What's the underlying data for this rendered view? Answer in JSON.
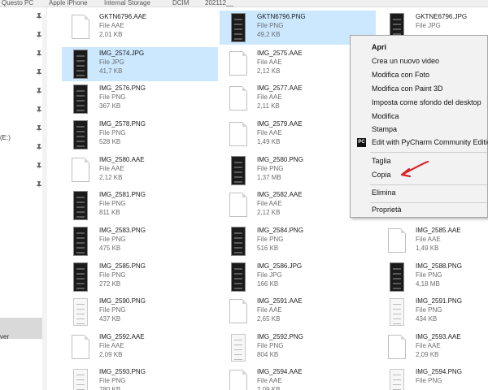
{
  "address": {
    "crumbs": [
      "Questo PC",
      "Apple iPhone",
      "Internal Storage",
      "DCIM",
      "202112__"
    ]
  },
  "nav": {
    "drive_label": "(E:)",
    "server_label": "ver"
  },
  "files": [
    {
      "name": "GKTN6796.AAE",
      "type": "File AAE",
      "size": "2,01 KB",
      "icon": "doc"
    },
    {
      "name": "GKTN6796.PNG",
      "type": "File PNG",
      "size": "49,2 KB",
      "icon": "phone"
    },
    {
      "name": "GKTNE6796.JPG",
      "type": "File JPG",
      "size": "",
      "icon": "phone"
    },
    {
      "name": "IMG_2574.JPG",
      "type": "File JPG",
      "size": "41,7 KB",
      "icon": "phone"
    },
    {
      "name": "IMG_2575.AAE",
      "type": "File AAE",
      "size": "2,12 KB",
      "icon": "doc"
    },
    {
      "name": "IMG_2576.PNG",
      "type": "File PNG",
      "size": "367 KB",
      "icon": "phone"
    },
    {
      "name": "IMG_2577.AAE",
      "type": "File AAE",
      "size": "2,11 KB",
      "icon": "doc"
    },
    {
      "name": "IMG_2578.PNG",
      "type": "File PNG",
      "size": "528 KB",
      "icon": "phone"
    },
    {
      "name": "IMG_2579.AAE",
      "type": "File AAE",
      "size": "1,49 KB",
      "icon": "doc"
    },
    {
      "name": "IMG_2580.AAE",
      "type": "File AAE",
      "size": "2,12 KB",
      "icon": "doc"
    },
    {
      "name": "IMG_2580.PNG",
      "type": "File PNG",
      "size": "1,37 MB",
      "icon": "phone"
    },
    {
      "name": "IMG_2581.PNG",
      "type": "File PNG",
      "size": "811 KB",
      "icon": "phone"
    },
    {
      "name": "IMG_2582.AAE",
      "type": "File AAE",
      "size": "2,12 KB",
      "icon": "doc"
    },
    {
      "name": "IMG_2583.PNG",
      "type": "File PNG",
      "size": "475 KB",
      "icon": "phone"
    },
    {
      "name": "IMG_2584.PNG",
      "type": "File PNG",
      "size": "516 KB",
      "icon": "phone"
    },
    {
      "name": "IMG_2585.AAE",
      "type": "File AAE",
      "size": "1,49 KB",
      "icon": "doc"
    },
    {
      "name": "IMG_2585.PNG",
      "type": "File PNG",
      "size": "272 KB",
      "icon": "phone"
    },
    {
      "name": "IMG_2586.JPG",
      "type": "File JPG",
      "size": "166 KB",
      "icon": "phone"
    },
    {
      "name": "IMG_2588.PNG",
      "type": "File PNG",
      "size": "4,18 MB",
      "icon": "phone"
    },
    {
      "name": "IMG_2590.PNG",
      "type": "File PNG",
      "size": "437 KB",
      "icon": "white"
    },
    {
      "name": "IMG_2591.AAE",
      "type": "File AAE",
      "size": "2,65 KB",
      "icon": "doc"
    },
    {
      "name": "IMG_2591.PNG",
      "type": "File PNG",
      "size": "434 KB",
      "icon": "white"
    },
    {
      "name": "IMG_2592.AAE",
      "type": "File AAE",
      "size": "2,09 KB",
      "icon": "doc"
    },
    {
      "name": "IMG_2592.PNG",
      "type": "File PNG",
      "size": "804 KB",
      "icon": "white"
    },
    {
      "name": "IMG_2593.AAE",
      "type": "File AAE",
      "size": "2,09 KB",
      "icon": "doc"
    },
    {
      "name": "IMG_2593.PNG",
      "type": "File PNG",
      "size": "780 KB",
      "icon": "white"
    },
    {
      "name": "IMG_2594.AAE",
      "type": "File AAE",
      "size": "2,09 KB",
      "icon": "doc"
    },
    {
      "name": "IMG_2594.PNG",
      "type": "File PNG",
      "size": "",
      "icon": "white"
    }
  ],
  "menu": {
    "apri": "Apri",
    "crea_video": "Crea un nuovo video",
    "modifica_foto": "Modifica con Foto",
    "modifica_paint3d": "Modifica con Paint 3D",
    "sfondo": "Imposta come sfondo del desktop",
    "modifica": "Modifica",
    "stampa": "Stampa",
    "pycharm": "Edit with PyCharm Community Edition",
    "pycharm_icon": "PC",
    "taglia": "Taglia",
    "copia": "Copia",
    "elimina": "Elimina",
    "proprieta": "Proprietà"
  },
  "colors": {
    "selection": "#cce8ff",
    "menu_bg": "#f2f2f2",
    "annotation_arrow": "#d9232d"
  }
}
